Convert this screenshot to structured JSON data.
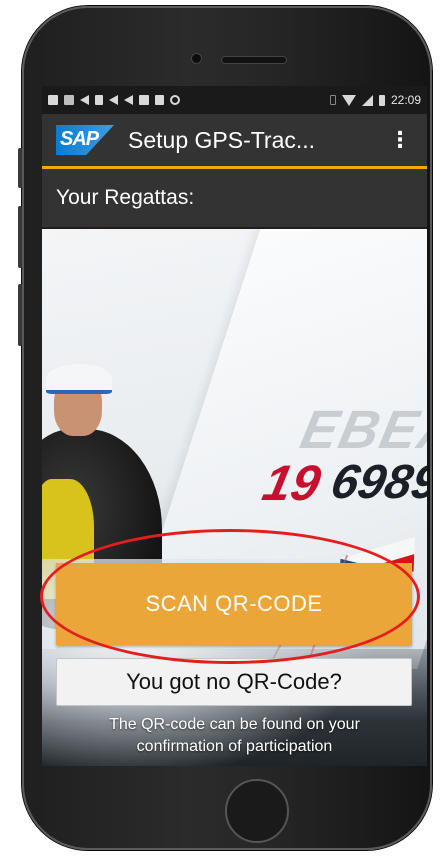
{
  "status_bar": {
    "time": "22:09",
    "icons": [
      "notification-icon",
      "calendar-icon",
      "send-icon",
      "media-icon",
      "send-icon",
      "send-icon",
      "image-icon",
      "lock-icon",
      "circle-icon",
      "vibrate-icon",
      "wifi-icon",
      "signal-icon",
      "battery-icon"
    ]
  },
  "app_bar": {
    "logo_text": "SAP",
    "title": "Setup GPS-Trac...",
    "overflow_symbol": "⋮"
  },
  "subheader": {
    "text": "Your Regattas:"
  },
  "hero": {
    "sail_number_top": "EBEA",
    "sail_number_red": "19",
    "sail_number_dark": "6989"
  },
  "actions": {
    "scan_button_label": "SCAN QR-CODE",
    "no_qr_button_label": "You got no QR-Code?",
    "hint_line1": "The QR-code can be found on your",
    "hint_line2": "confirmation of participation"
  },
  "colors": {
    "accent": "#f0ab00",
    "scan_button": "#eba63a",
    "app_bar": "#333333",
    "highlight_ring": "#e41e1e"
  }
}
